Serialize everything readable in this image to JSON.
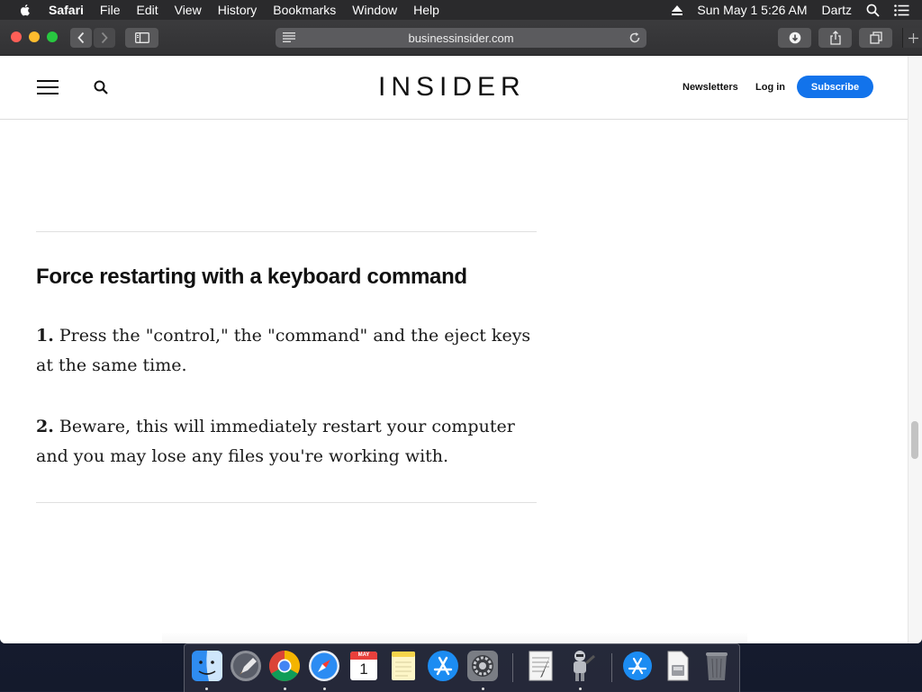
{
  "menubar": {
    "app_name": "Safari",
    "items": [
      "File",
      "Edit",
      "View",
      "History",
      "Bookmarks",
      "Window",
      "Help"
    ],
    "clock": "Sun May 1  5:26 AM",
    "user": "Dartz"
  },
  "browser": {
    "url": "businessinsider.com"
  },
  "site": {
    "logo": "INSIDER",
    "newsletters": "Newsletters",
    "login": "Log in",
    "subscribe": "Subscribe"
  },
  "article": {
    "heading": "Force restarting with a keyboard command",
    "steps": [
      {
        "num": "1.",
        "text": " Press the \"control,\" the \"command\" and the eject keys at the same time."
      },
      {
        "num": "2.",
        "text": " Beware, this will immediately restart your computer and you may lose any files you're working with."
      }
    ]
  },
  "dock": {
    "apps": [
      "finder-icon",
      "launchpad-icon",
      "chrome-icon",
      "safari-icon",
      "calendar-icon",
      "notes-icon",
      "app-store-icon",
      "system-preferences-icon",
      "textedit-icon",
      "automator-icon",
      "app-store-download-icon",
      "disk-image-icon",
      "trash-icon"
    ],
    "calendar_month": "MAY",
    "calendar_day": "1"
  }
}
